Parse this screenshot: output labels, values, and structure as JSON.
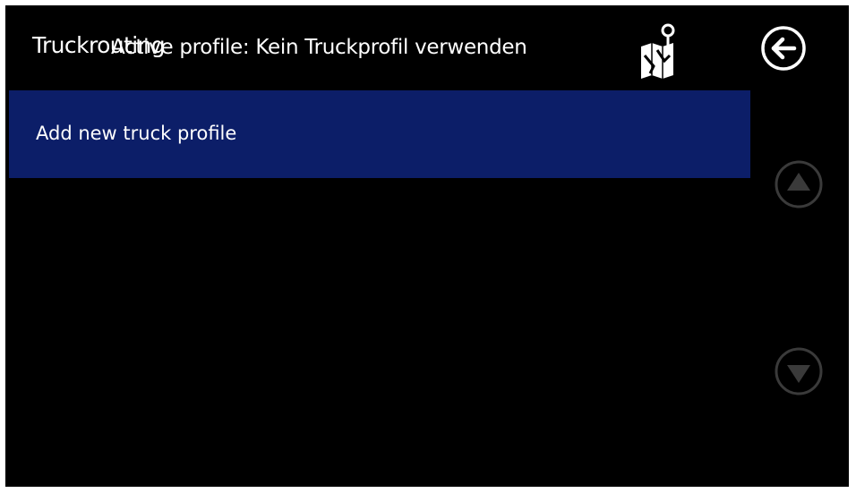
{
  "header": {
    "title": "Truckrouting",
    "subtitle": "Active profile: Kein Truckprofil verwenden",
    "map_icon": "map-pin-icon",
    "back_icon": "back-arrow-icon"
  },
  "list": {
    "items": [
      {
        "label": "Add new truck profile"
      }
    ]
  },
  "scroll": {
    "up_icon": "scroll-up-icon",
    "down_icon": "scroll-down-icon"
  },
  "colors": {
    "background": "#000000",
    "selected_item": "#0c1e68",
    "text": "#ffffff",
    "disabled_control": "#3a3a3a"
  }
}
